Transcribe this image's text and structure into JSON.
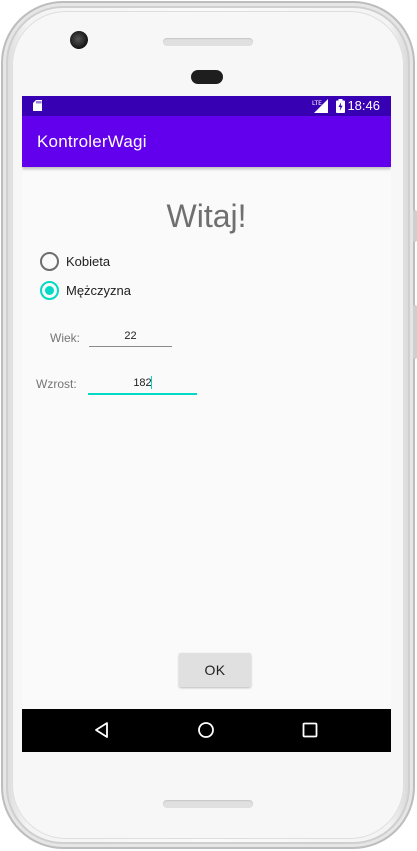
{
  "status_bar": {
    "time": "18:46",
    "network": "LTE",
    "background_color": "#3700b3"
  },
  "app_bar": {
    "title": "KontrolerWagi",
    "background_color": "#6200ee"
  },
  "main": {
    "greeting": "Witaj!",
    "gender_options": [
      {
        "label": "Kobieta",
        "checked": false
      },
      {
        "label": "Mężczyzna",
        "checked": true
      }
    ],
    "age": {
      "label": "Wiek:",
      "value": "22"
    },
    "height": {
      "label": "Wzrost:",
      "value": "182"
    },
    "ok_button_label": "OK",
    "accent_color": "#03dac5"
  },
  "nav_bar": {
    "icons": [
      "back-icon",
      "home-icon",
      "recents-icon"
    ]
  }
}
